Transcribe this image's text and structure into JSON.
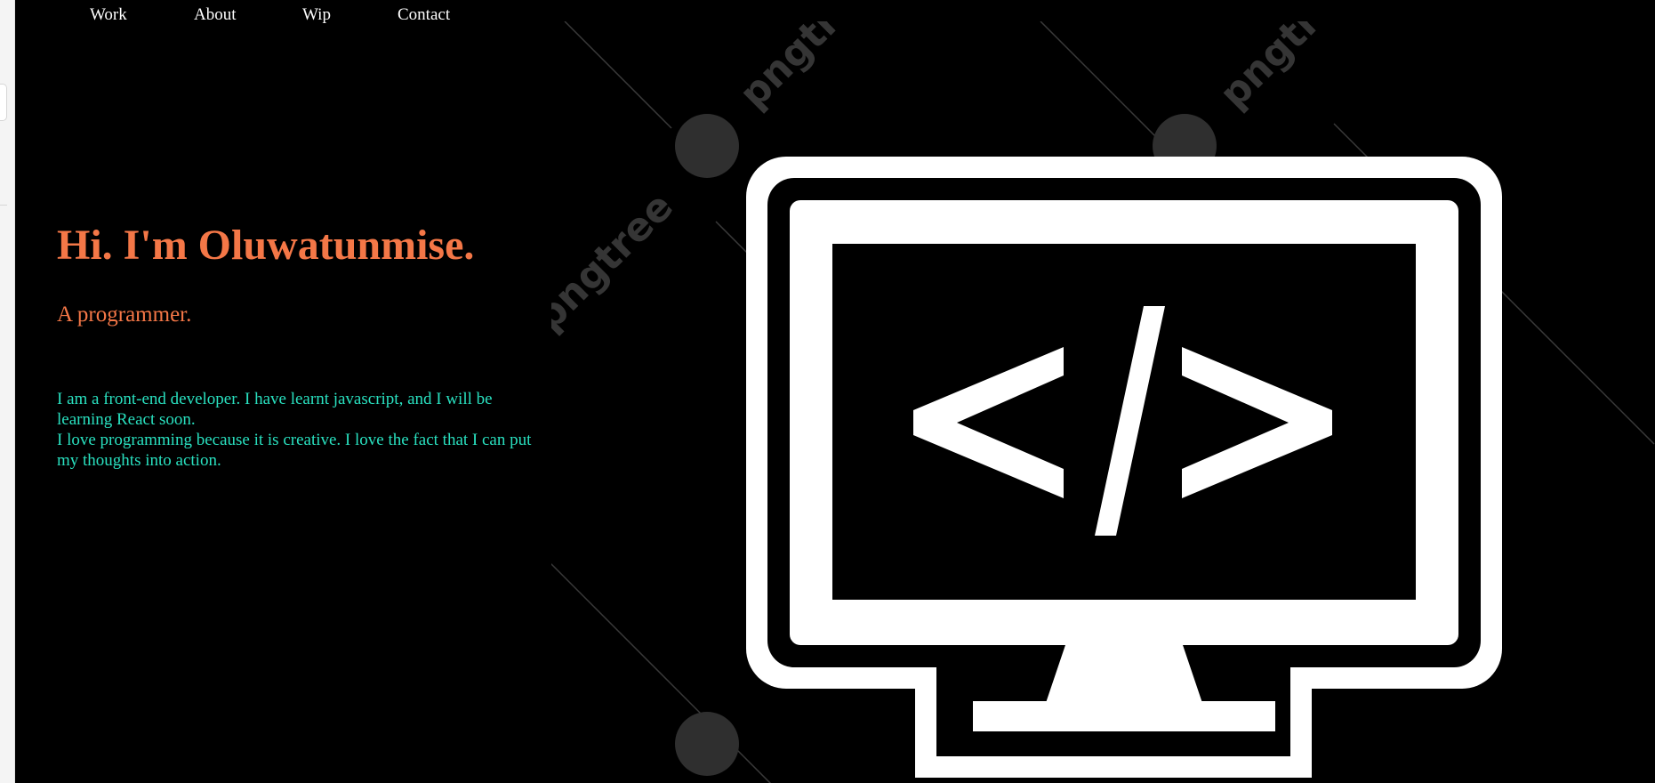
{
  "nav": {
    "items": [
      {
        "label": "Work"
      },
      {
        "label": "About"
      },
      {
        "label": "Wip"
      },
      {
        "label": "Contact"
      }
    ]
  },
  "hero": {
    "title": "Hi. I'm Oluwatunmise.",
    "subtitle": "A programmer.",
    "bio_lines": [
      "I am a front-end developer. I have learnt javascript, and I will be learning React soon.",
      "I love programming because it is creative. I love the fact that I can put my thoughts into action."
    ]
  },
  "illustration": {
    "icon": "monitor-code-icon",
    "code_glyph": "</>",
    "watermark_text": "pngtree"
  },
  "colors": {
    "background": "#000000",
    "accent": "#f47747",
    "bio_text": "#29e0bf",
    "nav_text": "#ffffff"
  }
}
